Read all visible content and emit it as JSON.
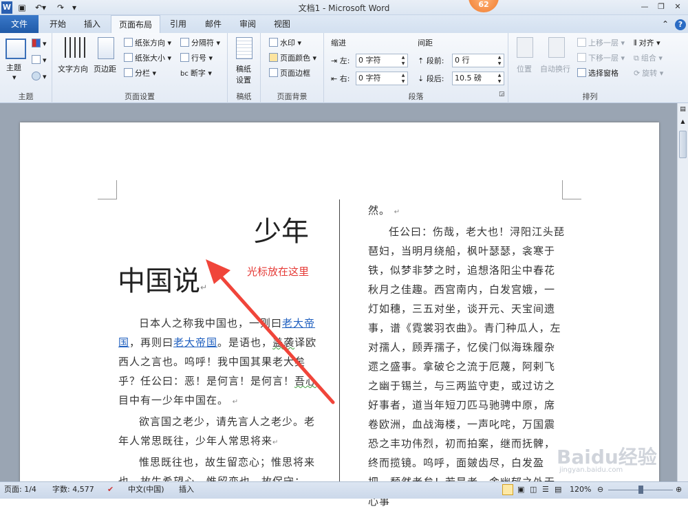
{
  "window": {
    "title": "文档1 - Microsoft Word",
    "badge": "62"
  },
  "tabs": [
    "文件",
    "开始",
    "插入",
    "页面布局",
    "引用",
    "邮件",
    "审阅",
    "视图"
  ],
  "ribbon": {
    "theme": {
      "btn": "主题",
      "group": "主题"
    },
    "page_setup": {
      "text_dir": "文字方向",
      "margins": "页边距",
      "orientation": "纸张方向",
      "size": "纸张大小",
      "columns": "分栏",
      "breaks": "分隔符",
      "line_numbers": "行号",
      "hyphenation": "断字",
      "group": "页面设置"
    },
    "draft": {
      "btn1": "稿纸",
      "btn2": "设置",
      "group": "稿纸"
    },
    "background": {
      "watermark": "水印",
      "page_color": "页面颜色",
      "page_border": "页面边框",
      "group": "页面背景"
    },
    "paragraph": {
      "indent": "缩进",
      "spacing": "间距",
      "left": "左:",
      "right": "右:",
      "before": "段前:",
      "after": "段后:",
      "left_val": "0 字符",
      "right_val": "0 字符",
      "before_val": "0 行",
      "after_val": "10.5 磅",
      "group": "段落"
    },
    "arrange": {
      "position": "位置",
      "wrap": "自动换行",
      "bring_forward": "上移一层",
      "send_backward": "下移一层",
      "selection_pane": "选择窗格",
      "align": "对齐",
      "group_btn": "组合",
      "rotate": "旋转",
      "group": "排列"
    }
  },
  "document": {
    "title1": "少年",
    "title2": "中国说",
    "annotation": "光标放在这里",
    "left_col": [
      [
        "日本人之称我中国也，一则曰",
        "老大帝国",
        "，再则曰",
        "老大帝国",
        "。是语也，",
        "盖袭",
        "译欧西人之言也。呜呼！我中国其果老大矣乎？任公曰：恶！是何言！是何言！",
        "吾心",
        "目中有一少年中国在。"
      ],
      [
        "欲言国之老少，请先言人之老少。老年人常思既往，少年人常思将来"
      ],
      [
        "惟思既往也，故生留恋心；惟思将来也，故生希望心。惟留恋也，故保守；"
      ]
    ],
    "right_col": [
      "然。",
      "任公曰：伤哉，老大也！浔阳江头琵琶妇，当明月绕船，枫叶瑟瑟，衾寒于铁，似梦非梦之时，追想洛阳尘中春花秋月之佳趣。西宫南内，白发宫娥，一灯如穗，三五对坐，谈开元、天宝间遗事，谱《霓裳羽衣曲》。青门种瓜人，左对孺人，顾弄孺子，忆侯门似海珠履杂遝之盛事。拿破仑之流于厄蔑，阿剌飞之幽于锡兰，与三两监守吏，或过访之好事者，道当年短刀匹马驰骋中原，席卷欧洲，血战海楼，一声叱咤，万国震恐之丰功伟烈，初而拍案，继而抚髀，终而揽镜。呜呼，面皴齿尽，白发盈把，颓然老矣！若是者，舍幽郁之外无心事"
    ]
  },
  "status": {
    "page": "页面: 1/4",
    "words": "字数: 4,577",
    "lang": "中文(中国)",
    "insert": "插入",
    "zoom": "120%"
  },
  "watermark": {
    "text": "Baidu经验",
    "url": "jingyan.baidu.com"
  }
}
